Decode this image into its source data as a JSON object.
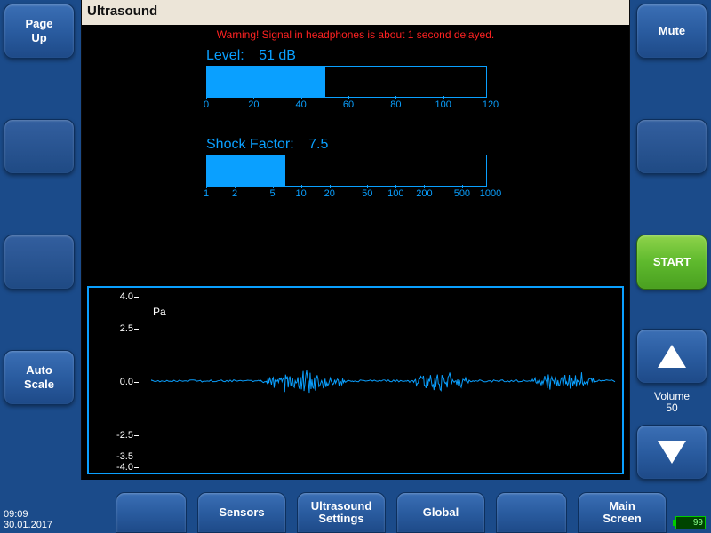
{
  "title": "Ultrasound",
  "warning": "Warning! Signal in headphones is about 1 second delayed.",
  "left_buttons": {
    "page_up": "Page\nUp",
    "auto_scale": "Auto\nScale"
  },
  "right_buttons": {
    "mute": "Mute",
    "start": "START",
    "volume_label": "Volume",
    "volume_value": "50"
  },
  "bottom_buttons": {
    "sensors": "Sensors",
    "ultrasound_settings": "Ultrasound\nSettings",
    "global": "Global",
    "main_screen": "Main\nScreen"
  },
  "level": {
    "label": "Level:",
    "value": "51 dB",
    "fill_percent": 42.5
  },
  "shock": {
    "label": "Shock Factor:",
    "value": "7.5",
    "fill_percent": 28
  },
  "waveform": {
    "unit": "Pa"
  },
  "status": {
    "time": "09:09",
    "date": "30.01.2017",
    "battery": "99"
  },
  "chart_data": [
    {
      "type": "bar",
      "title": "Level",
      "x": [
        51
      ],
      "xlim": [
        0,
        120
      ],
      "xticks": [
        0,
        20,
        40,
        60,
        80,
        100,
        120
      ],
      "unit": "dB",
      "scale": "linear"
    },
    {
      "type": "bar",
      "title": "Shock Factor",
      "x": [
        7.5
      ],
      "xlim": [
        1,
        1000
      ],
      "xticks": [
        1,
        2,
        5,
        10,
        20,
        50,
        100,
        200,
        500,
        1000
      ],
      "scale": "log"
    },
    {
      "type": "line",
      "title": "Ultrasound waveform",
      "ylabel": "Pa",
      "ylim": [
        -4.0,
        4.0
      ],
      "yticks": [
        -4.0,
        -3.5,
        -2.5,
        0.0,
        2.5,
        4.0
      ],
      "note": "continuous time-domain signal around 0 Pa; amplitude bursts roughly within ±0.8 Pa"
    }
  ]
}
